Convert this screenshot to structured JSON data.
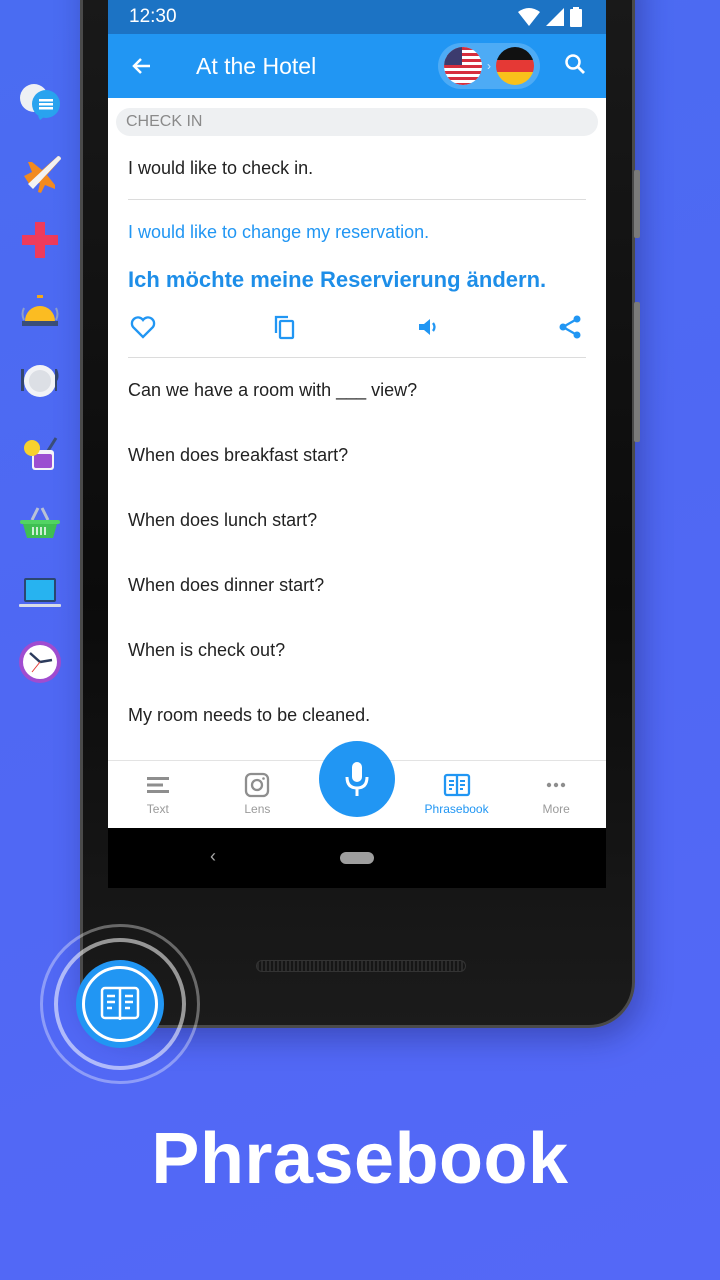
{
  "status_bar": {
    "time": "12:30"
  },
  "app_bar": {
    "title": "At the Hotel",
    "source_lang_flag": "us-flag",
    "target_lang_flag": "de-flag",
    "lang_arrow": "›"
  },
  "section": {
    "label": "CHECK IN"
  },
  "phrases": {
    "first": "I would like to check in.",
    "selected_en": "I would like to change my reservation.",
    "selected_de": "Ich möchte meine Reservierung ändern.",
    "list": [
      "Can we have a room with ___ view?",
      "When does breakfast start?",
      "When does lunch start?",
      "When does dinner start?",
      "When is check out?",
      "My room needs to be cleaned."
    ]
  },
  "actions": [
    "favorite-icon",
    "copy-icon",
    "speaker-icon",
    "share-icon"
  ],
  "bottom_nav": {
    "items": [
      {
        "label": "Text",
        "icon": "text-lines-icon",
        "active": false
      },
      {
        "label": "Lens",
        "icon": "camera-icon",
        "active": false
      },
      {
        "label": "Phrasebook",
        "icon": "book-icon",
        "active": true
      },
      {
        "label": "More",
        "icon": "more-dots-icon",
        "active": false
      }
    ],
    "mic_icon": "microphone-icon"
  },
  "system_nav": {
    "back": "‹"
  },
  "categories": [
    "conversation-icon",
    "airplane-icon",
    "medical-cross-icon",
    "hotel-bell-icon",
    "dining-plate-icon",
    "cocktail-icon",
    "shopping-basket-icon",
    "laptop-icon",
    "clock-icon"
  ],
  "colors": {
    "primary": "#2196f3",
    "status_bar": "#1c73c4",
    "background": "#4f68f3"
  },
  "headline": "Phrasebook"
}
